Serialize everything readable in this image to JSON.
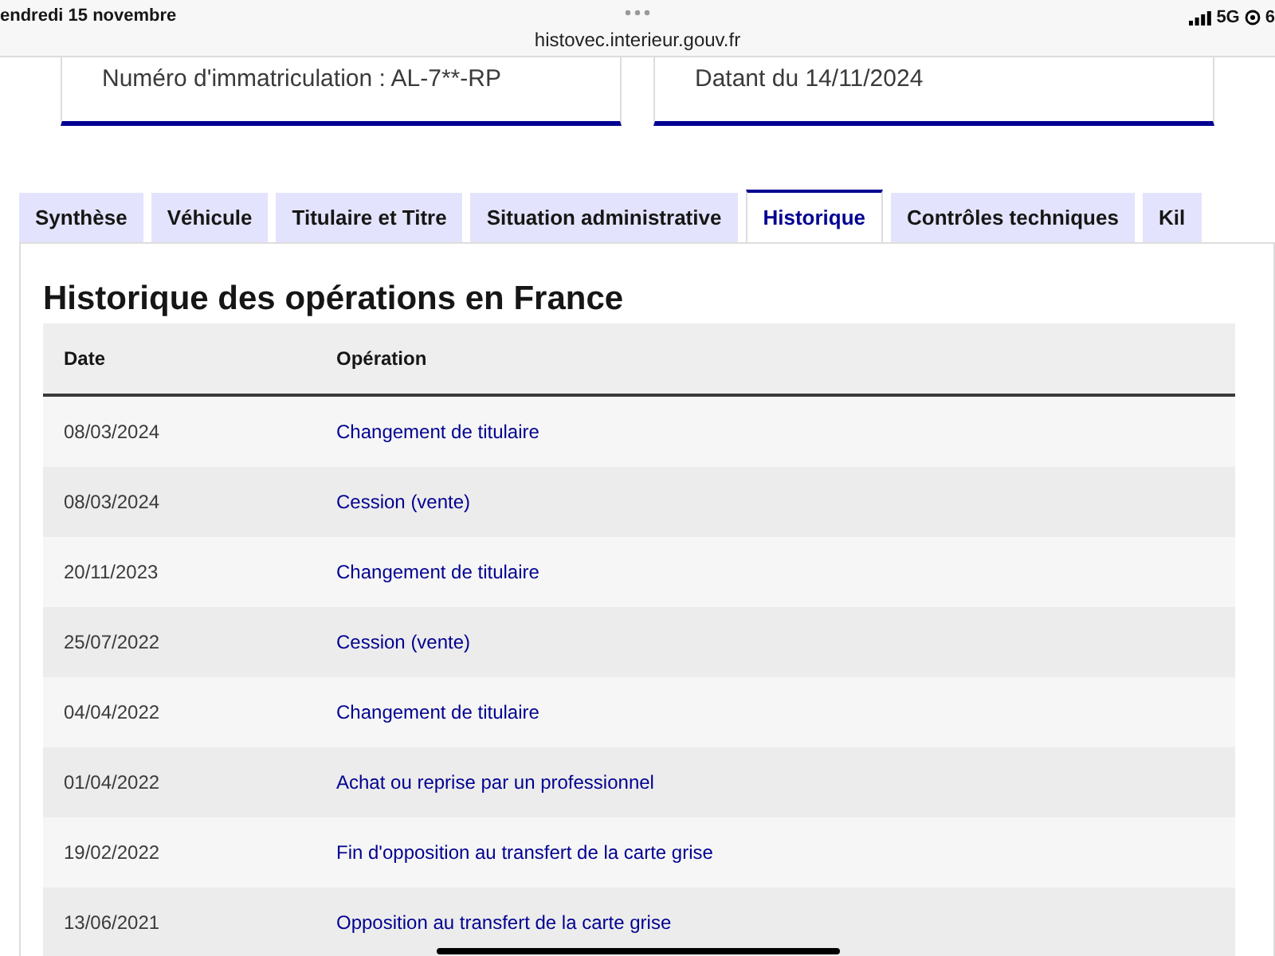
{
  "status_bar": {
    "date": "endredi 15 novembre",
    "url": "histovec.interieur.gouv.fr",
    "network": "5G",
    "battery": "6"
  },
  "cards": [
    {
      "text": "Numéro d'immatriculation : AL-7**-RP"
    },
    {
      "text": "Datant du 14/11/2024"
    }
  ],
  "tabs": [
    {
      "label": "Synthèse",
      "selected": false
    },
    {
      "label": "Véhicule",
      "selected": false
    },
    {
      "label": "Titulaire et Titre",
      "selected": false
    },
    {
      "label": "Situation administrative",
      "selected": false
    },
    {
      "label": "Historique",
      "selected": true
    },
    {
      "label": "Contrôles techniques",
      "selected": false
    },
    {
      "label": "Kil",
      "selected": false
    }
  ],
  "section_title": "Historique des opérations en France",
  "table": {
    "columns": [
      "Date",
      "Opération"
    ],
    "rows": [
      [
        "08/03/2024",
        "Changement de titulaire"
      ],
      [
        "08/03/2024",
        "Cession (vente)"
      ],
      [
        "20/11/2023",
        "Changement de titulaire"
      ],
      [
        "25/07/2022",
        "Cession (vente)"
      ],
      [
        "04/04/2022",
        "Changement de titulaire"
      ],
      [
        "01/04/2022",
        "Achat ou reprise par un professionnel"
      ],
      [
        "19/02/2022",
        "Fin d'opposition au transfert de la carte grise"
      ],
      [
        "13/06/2021",
        "Opposition au transfert de la carte grise"
      ]
    ]
  }
}
